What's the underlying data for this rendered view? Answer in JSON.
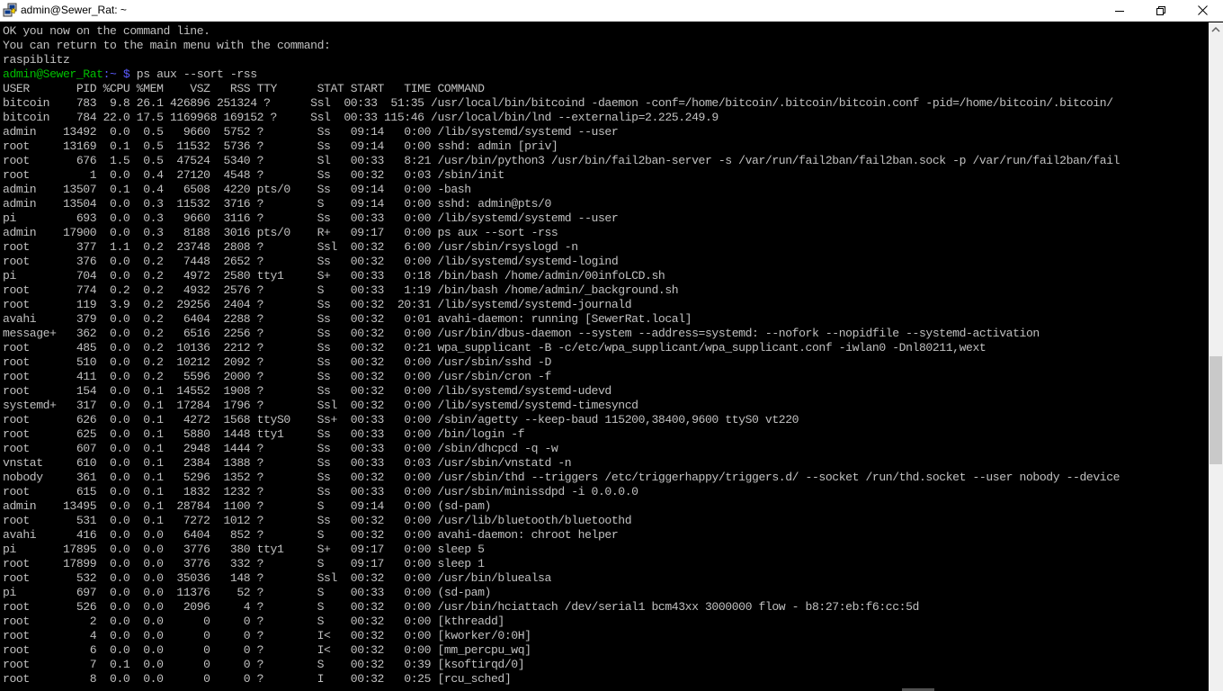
{
  "window": {
    "title": "admin@Sewer_Rat: ~",
    "app_icon": "putty-icon",
    "controls": [
      "minimize-icon",
      "maximize-icon",
      "close-icon"
    ]
  },
  "terminal": {
    "fg_color": "#c0c0c0",
    "bg_color": "#000000",
    "intro_lines": [
      "OK you now on the command line.",
      "You can return to the main menu with the command:",
      "raspiblitz"
    ],
    "prompt": {
      "user_host": "admin@Sewer_Rat",
      "path": ":~ $",
      "command": " ps aux --sort -rss"
    },
    "header": "USER       PID %CPU %MEM    VSZ   RSS TTY      STAT START   TIME COMMAND",
    "rows": [
      "bitcoin    783  9.8 26.1 426896 251324 ?      Ssl  00:33  51:35 /usr/local/bin/bitcoind -daemon -conf=/home/bitcoin/.bitcoin/bitcoin.conf -pid=/home/bitcoin/.bitcoin/",
      "bitcoin    784 22.0 17.5 1169968 169152 ?     Ssl  00:33 115:46 /usr/local/bin/lnd --externalip=2.225.249.9",
      "admin    13492  0.0  0.5   9660  5752 ?        Ss   09:14   0:00 /lib/systemd/systemd --user",
      "root     13169  0.1  0.5  11532  5736 ?        Ss   09:14   0:00 sshd: admin [priv]",
      "root       676  1.5  0.5  47524  5340 ?        Sl   00:33   8:21 /usr/bin/python3 /usr/bin/fail2ban-server -s /var/run/fail2ban/fail2ban.sock -p /var/run/fail2ban/fail",
      "root         1  0.0  0.4  27120  4548 ?        Ss   00:32   0:03 /sbin/init",
      "admin    13507  0.1  0.4   6508  4220 pts/0    Ss   09:14   0:00 -bash",
      "admin    13504  0.0  0.3  11532  3716 ?        S    09:14   0:00 sshd: admin@pts/0",
      "pi         693  0.0  0.3   9660  3116 ?        Ss   00:33   0:00 /lib/systemd/systemd --user",
      "admin    17900  0.0  0.3   8188  3016 pts/0    R+   09:17   0:00 ps aux --sort -rss",
      "root       377  1.1  0.2  23748  2808 ?        Ssl  00:32   6:00 /usr/sbin/rsyslogd -n",
      "root       376  0.0  0.2   7448  2652 ?        Ss   00:32   0:00 /lib/systemd/systemd-logind",
      "pi         704  0.0  0.2   4972  2580 tty1     S+   00:33   0:18 /bin/bash /home/admin/00infoLCD.sh",
      "root       774  0.2  0.2   4932  2576 ?        S    00:33   1:19 /bin/bash /home/admin/_background.sh",
      "root       119  3.9  0.2  29256  2404 ?        Ss   00:32  20:31 /lib/systemd/systemd-journald",
      "avahi      379  0.0  0.2   6404  2288 ?        Ss   00:32   0:01 avahi-daemon: running [SewerRat.local]",
      "message+   362  0.0  0.2   6516  2256 ?        Ss   00:32   0:00 /usr/bin/dbus-daemon --system --address=systemd: --nofork --nopidfile --systemd-activation",
      "root       485  0.0  0.2  10136  2212 ?        Ss   00:32   0:21 wpa_supplicant -B -c/etc/wpa_supplicant/wpa_supplicant.conf -iwlan0 -Dnl80211,wext",
      "root       510  0.0  0.2  10212  2092 ?        Ss   00:32   0:00 /usr/sbin/sshd -D",
      "root       411  0.0  0.2   5596  2000 ?        Ss   00:32   0:00 /usr/sbin/cron -f",
      "root       154  0.0  0.1  14552  1908 ?        Ss   00:32   0:00 /lib/systemd/systemd-udevd",
      "systemd+   317  0.0  0.1  17284  1796 ?        Ssl  00:32   0:00 /lib/systemd/systemd-timesyncd",
      "root       626  0.0  0.1   4272  1568 ttyS0    Ss+  00:33   0:00 /sbin/agetty --keep-baud 115200,38400,9600 ttyS0 vt220",
      "root       625  0.0  0.1   5880  1448 tty1     Ss   00:33   0:00 /bin/login -f",
      "root       607  0.0  0.1   2948  1444 ?        Ss   00:33   0:00 /sbin/dhcpcd -q -w",
      "vnstat     610  0.0  0.1   2384  1388 ?        Ss   00:33   0:03 /usr/sbin/vnstatd -n",
      "nobody     361  0.0  0.1   5296  1352 ?        Ss   00:32   0:00 /usr/sbin/thd --triggers /etc/triggerhappy/triggers.d/ --socket /run/thd.socket --user nobody --device",
      "root       615  0.0  0.1   1832  1232 ?        Ss   00:33   0:00 /usr/sbin/minissdpd -i 0.0.0.0",
      "admin    13495  0.0  0.1  28784  1100 ?        S    09:14   0:00 (sd-pam)",
      "root       531  0.0  0.1   7272  1012 ?        Ss   00:32   0:00 /usr/lib/bluetooth/bluetoothd",
      "avahi      416  0.0  0.0   6404   852 ?        S    00:32   0:00 avahi-daemon: chroot helper",
      "pi       17895  0.0  0.0   3776   380 tty1     S+   09:17   0:00 sleep 5",
      "root     17899  0.0  0.0   3776   332 ?        S    09:17   0:00 sleep 1",
      "root       532  0.0  0.0  35036   148 ?        Ssl  00:32   0:00 /usr/bin/bluealsa",
      "pi         697  0.0  0.0  11376    52 ?        S    00:33   0:00 (sd-pam)",
      "root       526  0.0  0.0   2096     4 ?        S    00:32   0:00 /usr/bin/hciattach /dev/serial1 bcm43xx 3000000 flow - b8:27:eb:f6:cc:5d",
      "root         2  0.0  0.0      0     0 ?        S    00:32   0:00 [kthreadd]",
      "root         4  0.0  0.0      0     0 ?        I<   00:32   0:00 [kworker/0:0H]",
      "root         6  0.0  0.0      0     0 ?        I<   00:32   0:00 [mm_percpu_wq]",
      "root         7  0.1  0.0      0     0 ?        S    00:32   0:39 [ksoftirqd/0]",
      "root         8  0.0  0.0      0     0 ?        I    00:32   0:25 [rcu_sched]"
    ]
  }
}
